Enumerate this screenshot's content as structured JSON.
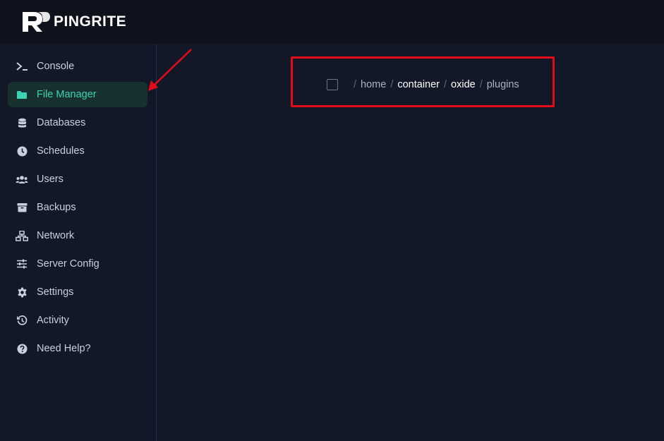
{
  "brand": {
    "name": "PINGRITE",
    "logo_icon": "pingrite-logo-icon"
  },
  "sidebar": {
    "items": [
      {
        "label": "Console",
        "icon": "terminal-icon",
        "active": false
      },
      {
        "label": "File Manager",
        "icon": "folder-icon",
        "active": true
      },
      {
        "label": "Databases",
        "icon": "database-icon",
        "active": false
      },
      {
        "label": "Schedules",
        "icon": "clock-icon",
        "active": false
      },
      {
        "label": "Users",
        "icon": "users-icon",
        "active": false
      },
      {
        "label": "Backups",
        "icon": "archive-icon",
        "active": false
      },
      {
        "label": "Network",
        "icon": "network-icon",
        "active": false
      },
      {
        "label": "Server Config",
        "icon": "sliders-icon",
        "active": false
      },
      {
        "label": "Settings",
        "icon": "gear-icon",
        "active": false
      },
      {
        "label": "Activity",
        "icon": "history-icon",
        "active": false
      },
      {
        "label": "Need Help?",
        "icon": "help-icon",
        "active": false
      }
    ]
  },
  "breadcrumb": {
    "separator": "/",
    "segments": [
      "home",
      "container",
      "oxide",
      "plugins"
    ]
  },
  "annotation": {
    "color": "#e30b17"
  },
  "colors": {
    "accent": "#3bd3b3",
    "active_bg": "#173131",
    "background": "#121827",
    "topbar": "#0d121d"
  }
}
